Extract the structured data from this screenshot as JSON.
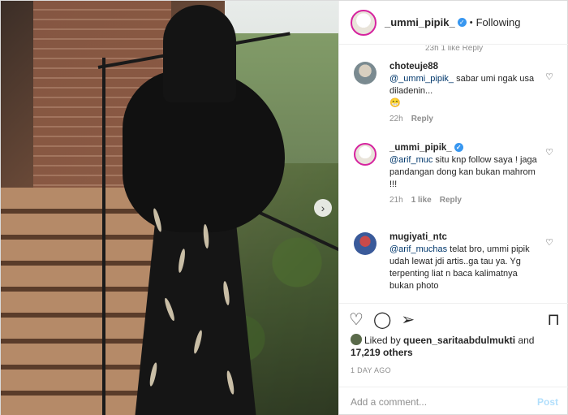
{
  "post": {
    "username": "_ummi_pipik_",
    "separator": "•",
    "follow_status": "Following"
  },
  "comments": [
    {
      "username": "choteuje88",
      "mention": "@_ummi_pipik_",
      "text": " sabar umi ngak usa diladenin...",
      "emoji": "😁",
      "time": "22h",
      "reply": "Reply"
    },
    {
      "username": "_ummi_pipik_",
      "verified": true,
      "mention": "@arif_muc",
      "text": " situ knp follow saya ! jaga pandangan dong kan bukan mahrom !!!",
      "time": "21h",
      "likes": "1 like",
      "reply": "Reply"
    },
    {
      "username": "mugiyati_ntc",
      "mention": "@arif_muchas",
      "text": " telat bro, ummi pipik udah lewat jdi artis..ga tau ya. Yg terpenting liat n baca kalimatnya bukan photo"
    }
  ],
  "truncated_top": "23h  1 like  Reply",
  "likes": {
    "prefix": "Liked by ",
    "user": "queen_saritaabdulmukti",
    "middle": " and",
    "count": "17,219 others"
  },
  "date": "1 DAY AGO",
  "add_comment": {
    "placeholder": "Add a comment...",
    "post_label": "Post"
  },
  "icons": {
    "heart": "heart-icon",
    "comment": "comment-icon",
    "share": "share-icon",
    "bookmark": "bookmark-icon",
    "verified": "verified-badge-icon",
    "next": "chevron-right-icon"
  }
}
